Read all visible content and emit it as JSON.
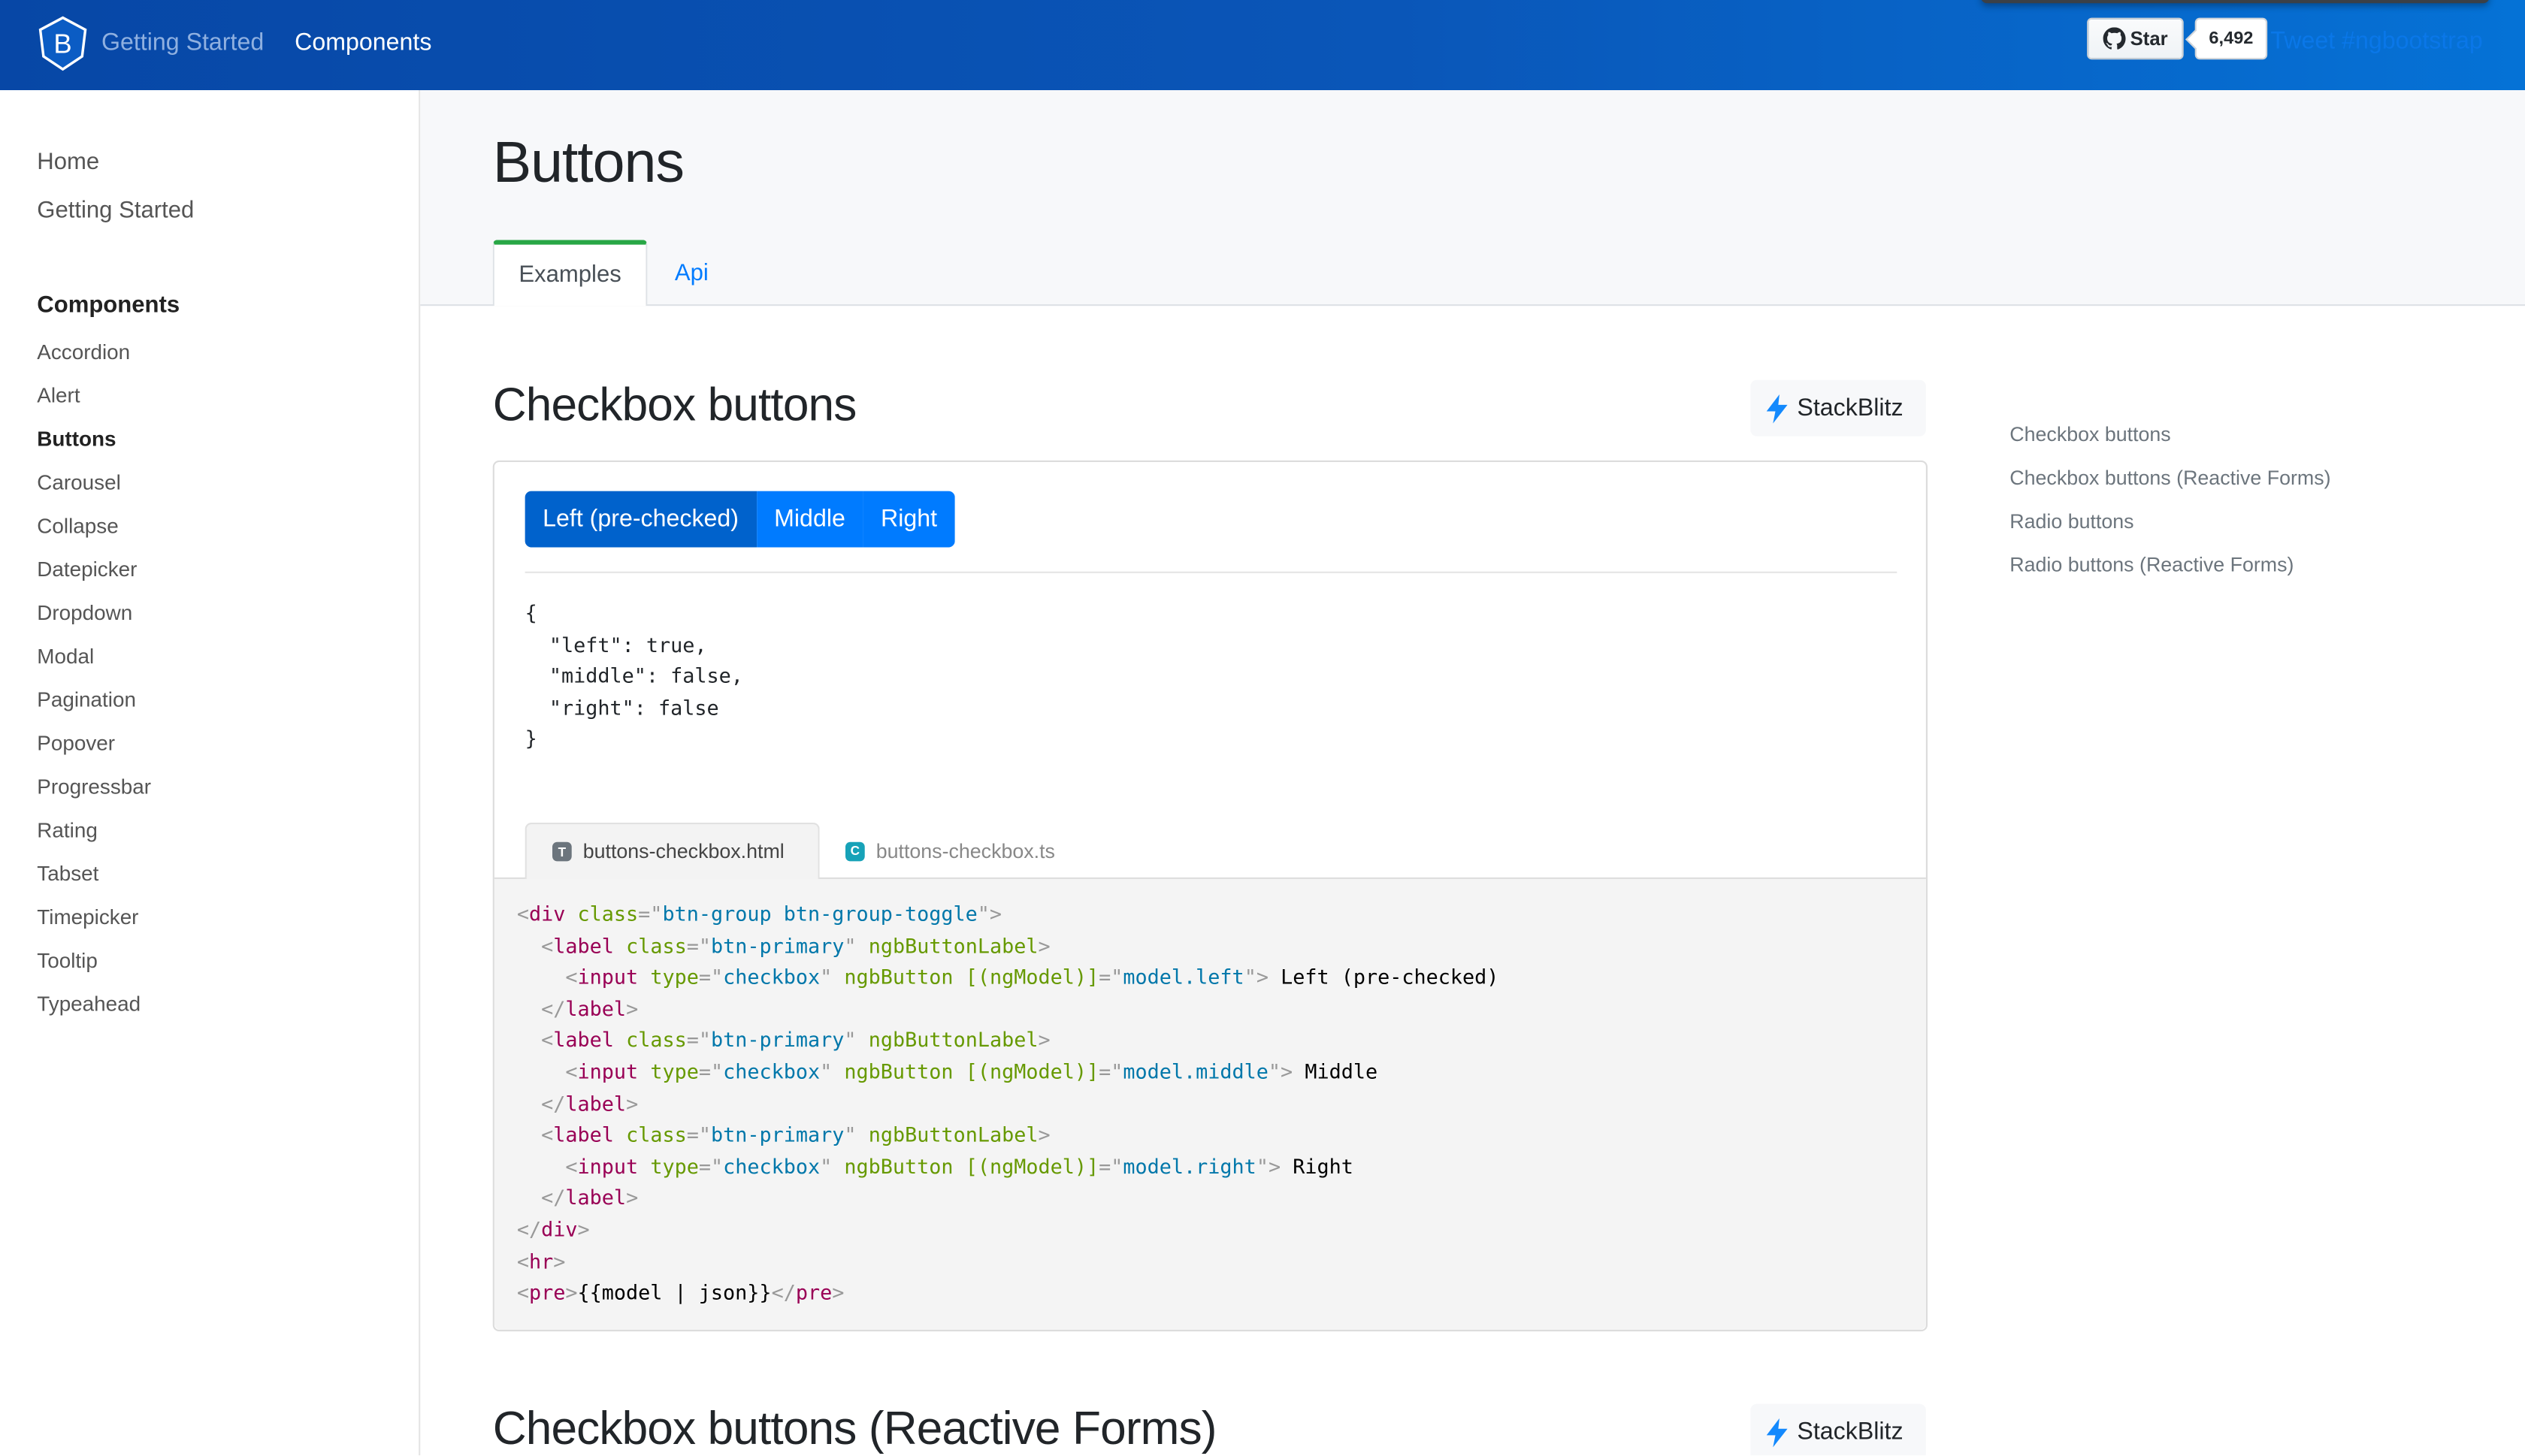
{
  "header": {
    "logo_letter": "B",
    "nav": [
      {
        "label": "Getting Started",
        "active": false
      },
      {
        "label": "Components",
        "active": true
      }
    ],
    "github": {
      "star_label": "Star",
      "count": "6,492"
    },
    "tweet_label": "Tweet #ngbootstrap"
  },
  "sidebar": {
    "top_links": [
      "Home",
      "Getting Started"
    ],
    "components_heading": "Components",
    "items": [
      {
        "label": "Accordion"
      },
      {
        "label": "Alert"
      },
      {
        "label": "Buttons",
        "active": true
      },
      {
        "label": "Carousel"
      },
      {
        "label": "Collapse"
      },
      {
        "label": "Datepicker"
      },
      {
        "label": "Dropdown"
      },
      {
        "label": "Modal"
      },
      {
        "label": "Pagination"
      },
      {
        "label": "Popover"
      },
      {
        "label": "Progressbar"
      },
      {
        "label": "Rating"
      },
      {
        "label": "Tabset"
      },
      {
        "label": "Timepicker"
      },
      {
        "label": "Tooltip"
      },
      {
        "label": "Typeahead"
      }
    ]
  },
  "page": {
    "title": "Buttons",
    "tabs": [
      {
        "label": "Examples",
        "active": true
      },
      {
        "label": "Api",
        "active": false
      }
    ]
  },
  "sections": [
    {
      "title": "Checkbox buttons",
      "stackblitz_label": "StackBlitz",
      "buttons": [
        {
          "label": "Left (pre-checked)",
          "checked": true
        },
        {
          "label": "Middle",
          "checked": false
        },
        {
          "label": "Right",
          "checked": false
        }
      ],
      "model_output": "{\n  \"left\": true,\n  \"middle\": false,\n  \"right\": false\n}",
      "code_tabs": [
        {
          "label": "buttons-checkbox.html",
          "badge": "T",
          "active": true
        },
        {
          "label": "buttons-checkbox.ts",
          "badge": "C",
          "active": false
        }
      ],
      "code_lines": [
        [
          [
            "p",
            "<"
          ],
          [
            "tg",
            "div"
          ],
          [
            "tx",
            " "
          ],
          [
            "at",
            "class"
          ],
          [
            "p",
            "=\""
          ],
          [
            "st",
            "btn-group btn-group-toggle"
          ],
          [
            "p",
            "\">"
          ]
        ],
        [
          [
            "tx",
            "  "
          ],
          [
            "p",
            "<"
          ],
          [
            "tg",
            "label"
          ],
          [
            "tx",
            " "
          ],
          [
            "at",
            "class"
          ],
          [
            "p",
            "=\""
          ],
          [
            "st",
            "btn-primary"
          ],
          [
            "p",
            "\""
          ],
          [
            "tx",
            " "
          ],
          [
            "at",
            "ngbButtonLabel"
          ],
          [
            "p",
            ">"
          ]
        ],
        [
          [
            "tx",
            "    "
          ],
          [
            "p",
            "<"
          ],
          [
            "tg",
            "input"
          ],
          [
            "tx",
            " "
          ],
          [
            "at",
            "type"
          ],
          [
            "p",
            "=\""
          ],
          [
            "st",
            "checkbox"
          ],
          [
            "p",
            "\""
          ],
          [
            "tx",
            " "
          ],
          [
            "at",
            "ngbButton"
          ],
          [
            "tx",
            " "
          ],
          [
            "at",
            "[(ngModel)]"
          ],
          [
            "p",
            "=\""
          ],
          [
            "st",
            "model.left"
          ],
          [
            "p",
            "\">"
          ],
          [
            "tx",
            " Left (pre-checked)"
          ]
        ],
        [
          [
            "tx",
            "  "
          ],
          [
            "p",
            "</"
          ],
          [
            "tg",
            "label"
          ],
          [
            "p",
            ">"
          ]
        ],
        [
          [
            "tx",
            "  "
          ],
          [
            "p",
            "<"
          ],
          [
            "tg",
            "label"
          ],
          [
            "tx",
            " "
          ],
          [
            "at",
            "class"
          ],
          [
            "p",
            "=\""
          ],
          [
            "st",
            "btn-primary"
          ],
          [
            "p",
            "\""
          ],
          [
            "tx",
            " "
          ],
          [
            "at",
            "ngbButtonLabel"
          ],
          [
            "p",
            ">"
          ]
        ],
        [
          [
            "tx",
            "    "
          ],
          [
            "p",
            "<"
          ],
          [
            "tg",
            "input"
          ],
          [
            "tx",
            " "
          ],
          [
            "at",
            "type"
          ],
          [
            "p",
            "=\""
          ],
          [
            "st",
            "checkbox"
          ],
          [
            "p",
            "\""
          ],
          [
            "tx",
            " "
          ],
          [
            "at",
            "ngbButton"
          ],
          [
            "tx",
            " "
          ],
          [
            "at",
            "[(ngModel)]"
          ],
          [
            "p",
            "=\""
          ],
          [
            "st",
            "model.middle"
          ],
          [
            "p",
            "\">"
          ],
          [
            "tx",
            " Middle"
          ]
        ],
        [
          [
            "tx",
            "  "
          ],
          [
            "p",
            "</"
          ],
          [
            "tg",
            "label"
          ],
          [
            "p",
            ">"
          ]
        ],
        [
          [
            "tx",
            "  "
          ],
          [
            "p",
            "<"
          ],
          [
            "tg",
            "label"
          ],
          [
            "tx",
            " "
          ],
          [
            "at",
            "class"
          ],
          [
            "p",
            "=\""
          ],
          [
            "st",
            "btn-primary"
          ],
          [
            "p",
            "\""
          ],
          [
            "tx",
            " "
          ],
          [
            "at",
            "ngbButtonLabel"
          ],
          [
            "p",
            ">"
          ]
        ],
        [
          [
            "tx",
            "    "
          ],
          [
            "p",
            "<"
          ],
          [
            "tg",
            "input"
          ],
          [
            "tx",
            " "
          ],
          [
            "at",
            "type"
          ],
          [
            "p",
            "=\""
          ],
          [
            "st",
            "checkbox"
          ],
          [
            "p",
            "\""
          ],
          [
            "tx",
            " "
          ],
          [
            "at",
            "ngbButton"
          ],
          [
            "tx",
            " "
          ],
          [
            "at",
            "[(ngModel)]"
          ],
          [
            "p",
            "=\""
          ],
          [
            "st",
            "model.right"
          ],
          [
            "p",
            "\">"
          ],
          [
            "tx",
            " Right"
          ]
        ],
        [
          [
            "tx",
            "  "
          ],
          [
            "p",
            "</"
          ],
          [
            "tg",
            "label"
          ],
          [
            "p",
            ">"
          ]
        ],
        [
          [
            "p",
            "</"
          ],
          [
            "tg",
            "div"
          ],
          [
            "p",
            ">"
          ]
        ],
        [
          [
            "p",
            "<"
          ],
          [
            "tg",
            "hr"
          ],
          [
            "p",
            ">"
          ]
        ],
        [
          [
            "p",
            "<"
          ],
          [
            "tg",
            "pre"
          ],
          [
            "p",
            ">"
          ],
          [
            "tx",
            "{{model | json}}"
          ],
          [
            "p",
            "</"
          ],
          [
            "tg",
            "pre"
          ],
          [
            "p",
            ">"
          ]
        ]
      ]
    },
    {
      "title": "Checkbox buttons (Reactive Forms)",
      "stackblitz_label": "StackBlitz"
    }
  ],
  "toc": [
    "Checkbox buttons",
    "Checkbox buttons (Reactive Forms)",
    "Radio buttons",
    "Radio buttons (Reactive Forms)"
  ],
  "colors": {
    "primary": "#007bff",
    "primary_checked": "#0062cc",
    "active_tab_accent": "#28a745",
    "header_gradient_start": "#0747a6",
    "header_gradient_end": "#0572d6"
  }
}
